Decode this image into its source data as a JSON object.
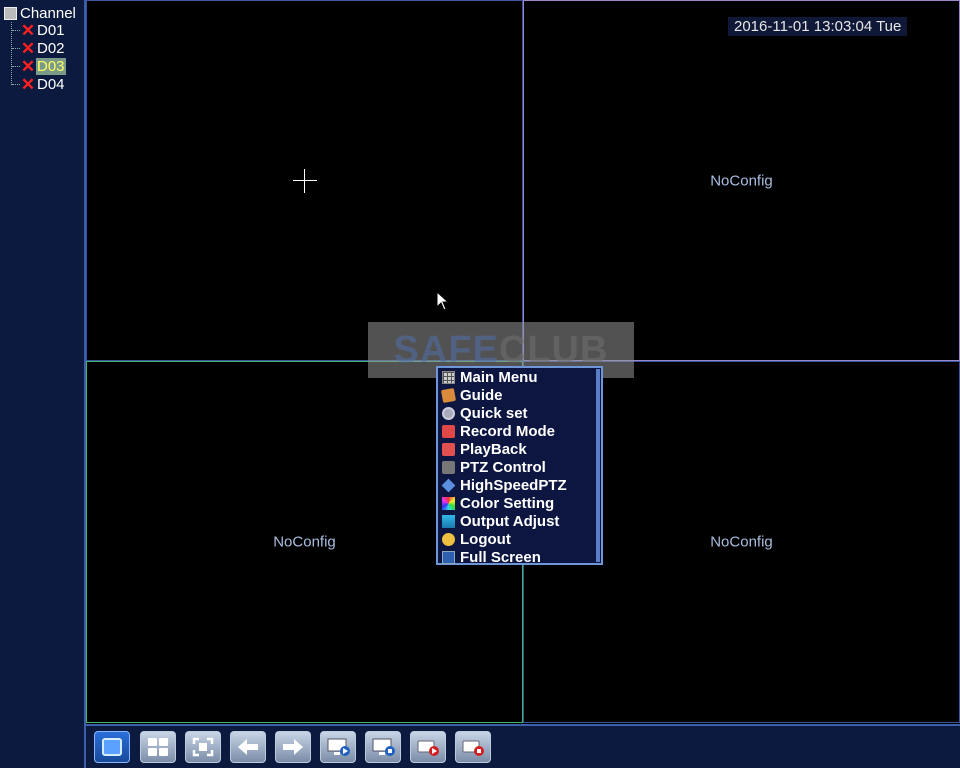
{
  "sidebar": {
    "root_label": "Channel",
    "channels": [
      {
        "label": "D01",
        "selected": false
      },
      {
        "label": "D02",
        "selected": false
      },
      {
        "label": "D03",
        "selected": true
      },
      {
        "label": "D04",
        "selected": false
      }
    ]
  },
  "grid": {
    "no_config_label": "NoConfig"
  },
  "overlay": {
    "datetime": "2016-11-01 13:03:04 Tue"
  },
  "watermark": {
    "part1": "SAFE",
    "part2": "CLUB"
  },
  "context_menu": {
    "items": [
      {
        "label": "Main Menu",
        "icon": "main-menu-icon"
      },
      {
        "label": "Guide",
        "icon": "guide-icon"
      },
      {
        "label": "Quick set",
        "icon": "quick-set-icon"
      },
      {
        "label": "Record Mode",
        "icon": "record-mode-icon"
      },
      {
        "label": "PlayBack",
        "icon": "playback-icon"
      },
      {
        "label": "PTZ Control",
        "icon": "ptz-control-icon"
      },
      {
        "label": "HighSpeedPTZ",
        "icon": "high-speed-ptz-icon"
      },
      {
        "label": "Color Setting",
        "icon": "color-setting-icon"
      },
      {
        "label": "Output Adjust",
        "icon": "output-adjust-icon"
      },
      {
        "label": "Logout",
        "icon": "logout-icon"
      },
      {
        "label": "Full Screen",
        "icon": "full-screen-icon"
      }
    ]
  },
  "toolbar": {
    "buttons": [
      "single-view-icon",
      "quad-view-icon",
      "fit-screen-icon",
      "previous-icon",
      "next-icon",
      "playback-monitor-icon",
      "screen-settings-icon",
      "record-start-icon",
      "record-stop-icon"
    ]
  }
}
